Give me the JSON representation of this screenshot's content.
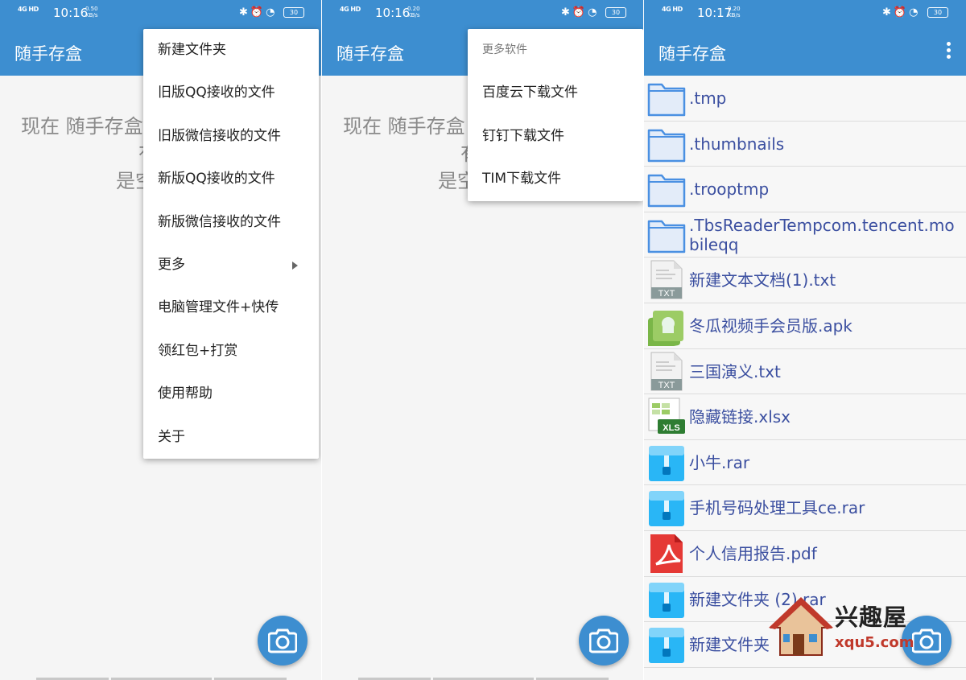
{
  "app_title": "随手存盒",
  "panels": [
    {
      "signal": "4G HD",
      "time": "10:16",
      "speed_val": "0.50",
      "speed_unit": "KB/s",
      "battery": "30"
    },
    {
      "signal": "4G HD",
      "time": "10:16",
      "speed_val": "0.20",
      "speed_unit": "KB/s",
      "battery": "30"
    },
    {
      "signal": "4G HD",
      "time": "10:17",
      "speed_val": "0.20",
      "speed_unit": "KB/s",
      "battery": "30"
    }
  ],
  "empty_message": {
    "line1": "现在 随手存盒",
    "line2": "有",
    "line3": "是空"
  },
  "main_menu": {
    "items": [
      "新建文件夹",
      "旧版QQ接收的文件",
      "旧版微信接收的文件",
      "新版QQ接收的文件",
      "新版微信接收的文件",
      "更多",
      "电脑管理文件+快传",
      "领红包+打赏",
      "使用帮助",
      "关于"
    ]
  },
  "more_menu": {
    "header": "更多软件",
    "items": [
      "百度云下载文件",
      "钉钉下载文件",
      "TIM下载文件"
    ]
  },
  "files": [
    {
      "name": ".tmp",
      "type": "folder"
    },
    {
      "name": ".thumbnails",
      "type": "folder"
    },
    {
      "name": ".trooptmp",
      "type": "folder"
    },
    {
      "name": ".TbsReaderTempcom.tencent.mobileqq",
      "type": "folder"
    },
    {
      "name": "新建文本文档(1).txt",
      "type": "txt"
    },
    {
      "name": "冬瓜视频手会员版.apk",
      "type": "apk"
    },
    {
      "name": "三国演义.txt",
      "type": "txt"
    },
    {
      "name": "隐藏链接.xlsx",
      "type": "xls"
    },
    {
      "name": "小牛.rar",
      "type": "rar"
    },
    {
      "name": "手机号码处理工具ce.rar",
      "type": "rar"
    },
    {
      "name": "个人信用报告.pdf",
      "type": "pdf"
    },
    {
      "name": "新建文件夹 (2).rar",
      "type": "rar"
    },
    {
      "name": "新建文件夹",
      "type": "rar"
    }
  ],
  "icon_labels": {
    "txt": "TXT",
    "xls": "XLS"
  },
  "watermark": {
    "title": "兴趣屋",
    "url": "xqu5.com"
  },
  "colors": {
    "primary": "#3d8ed0",
    "file_text": "#3b4fa0",
    "folder": "#4a90e2"
  }
}
